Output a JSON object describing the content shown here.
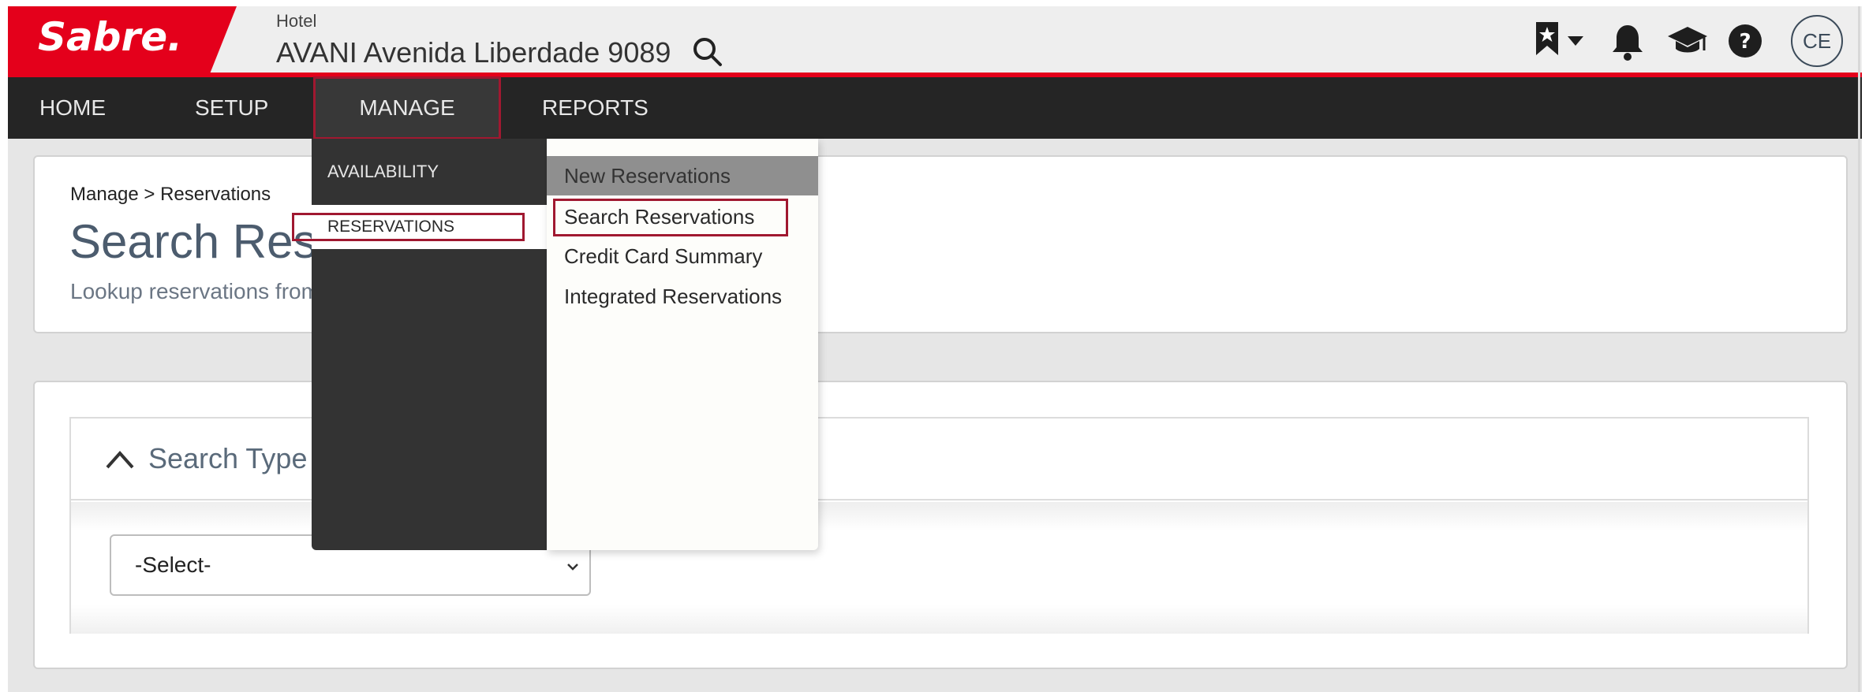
{
  "brand": {
    "logo_text": "Sabre.",
    "accent": "#e4001b",
    "nav_bg": "#252525",
    "highlight": "#a01830"
  },
  "header": {
    "context_label": "Hotel",
    "property_name": "AVANI Avenida Liberdade 9089",
    "icons": [
      "search-icon",
      "bookmark-icon",
      "caret-down-icon",
      "bell-icon",
      "graduation-cap-icon",
      "help-icon"
    ],
    "user_initials": "CE"
  },
  "nav": {
    "items": [
      {
        "label": "HOME"
      },
      {
        "label": "SETUP"
      },
      {
        "label": "MANAGE",
        "active": true
      },
      {
        "label": "REPORTS"
      }
    ]
  },
  "dropdown": {
    "categories": [
      {
        "label": "AVAILABILITY"
      },
      {
        "label": "RESERVATIONS",
        "active": true
      }
    ],
    "items": [
      {
        "label": "New Reservations"
      },
      {
        "label": "Search Reservations",
        "highlighted": true
      },
      {
        "label": "Credit Card Summary"
      },
      {
        "label": "Integrated Reservations"
      }
    ]
  },
  "page": {
    "breadcrumb": "Manage > Reservations",
    "title": "Search Reservations",
    "subtitle": "Lookup reservations from your property"
  },
  "search_panel": {
    "title": "Search Type",
    "select_value": "-Select-"
  }
}
